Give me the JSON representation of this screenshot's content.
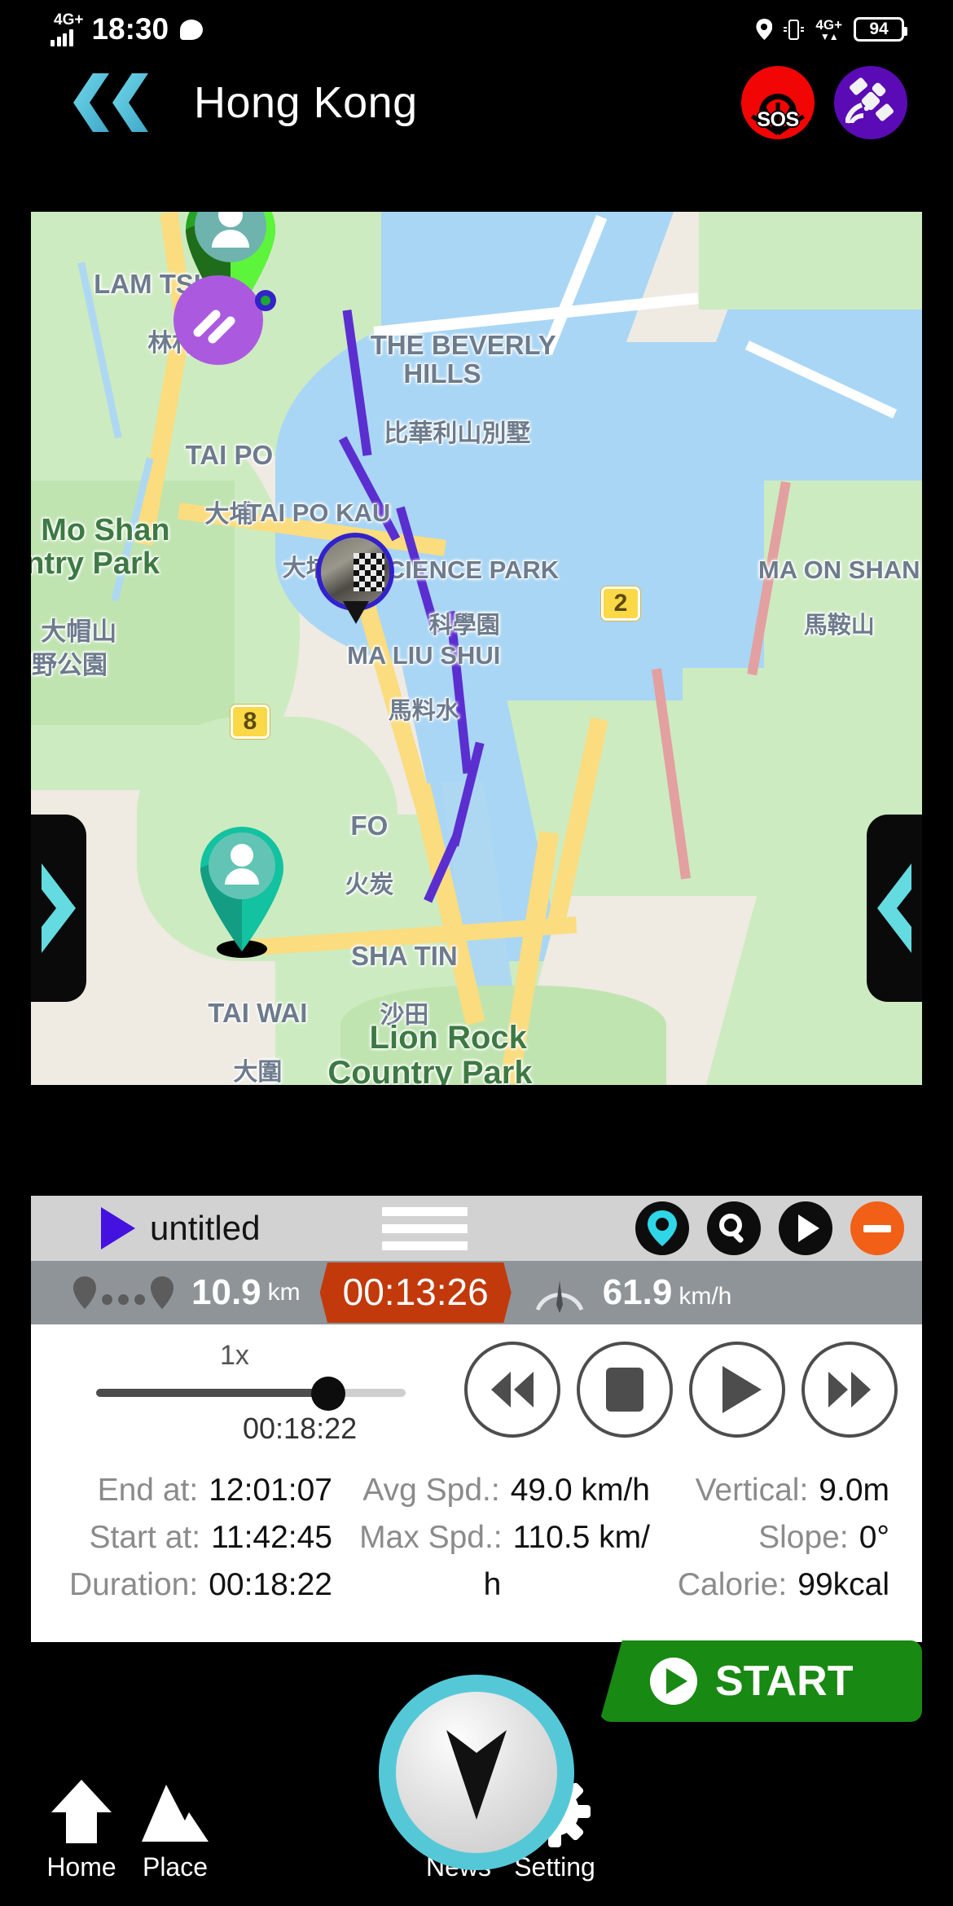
{
  "status_bar": {
    "network_label": "4G+",
    "time": "18:30",
    "message_icon": "message-bubble-icon",
    "location_icon": "location-pin-icon",
    "vibrate_icon": "vibrate-icon",
    "data_network_label": "4G+",
    "battery_level": "94"
  },
  "header": {
    "back_label": "back-double-chevron",
    "title": "Hong Kong",
    "sos_label": "SOS",
    "satellite_icon": "satellite-icon"
  },
  "map": {
    "labels": [
      {
        "en": "LAM TSUEN",
        "zh": "林村"
      },
      {
        "en": "THE BEVERLY\nHILLS",
        "zh": "比華利山別墅"
      },
      {
        "en": "TAI PO",
        "zh": "大埔"
      },
      {
        "en": "TAI PO KAU",
        "zh": "大埔滘"
      },
      {
        "en": "SCIENCE PARK",
        "zh": "科學園"
      },
      {
        "en": "MA ON SHAN",
        "zh": "馬鞍山"
      },
      {
        "en": "MA LIU SHUI",
        "zh": "馬料水"
      },
      {
        "en": "Mo Shan\nuntry Park",
        "zh": "大帽山\n郊野公園"
      },
      {
        "en": "FO",
        "zh": "火炭"
      },
      {
        "en": "SHA TIN",
        "zh": "沙田"
      },
      {
        "en": "TAI WAI",
        "zh": "大圍"
      },
      {
        "en": "Lion Rock\nCountry Park",
        "zh": ""
      }
    ],
    "route_shields": [
      "2",
      "8"
    ],
    "left_arrow_icon": "chevron-right-icon",
    "right_arrow_icon": "chevron-left-icon",
    "markers": {
      "green_pin": "person-marker-green",
      "teal_pin": "person-marker-teal",
      "heading_marker": "direction-heading-marker",
      "start_dot": "route-start-dot",
      "photo_marker": "photo-thumbnail-marker"
    }
  },
  "control_bar": {
    "play_icon": "play-triangle-icon",
    "track_title": "untitled",
    "menu_icon": "hamburger-menu-icon",
    "locate_icon": "locate-pin-icon",
    "search_icon": "search-icon",
    "play_circle_icon": "play-circle-icon",
    "minus_icon": "minus-circle-icon"
  },
  "stats_bar": {
    "distance_icon": "distance-icon",
    "distance_value": "10.9",
    "distance_unit": "km",
    "elapsed_time": "00:13:26",
    "speed_icon": "speedometer-icon",
    "speed_value": "61.9",
    "speed_unit": "km/h"
  },
  "playback": {
    "speed_label": "1x",
    "position_time": "00:18:22",
    "progress_percent": 75,
    "rewind_icon": "rewind-icon",
    "stop_icon": "stop-icon",
    "play_icon": "play-icon",
    "forward_icon": "fast-forward-icon"
  },
  "details": {
    "rows": [
      [
        {
          "label": "End at:",
          "value": "12:01:07"
        },
        {
          "label": "Avg Spd.:",
          "value": "49.0 km/h"
        },
        {
          "label": "Vertical:",
          "value": "9.0m"
        }
      ],
      [
        {
          "label": "Start at:",
          "value": "11:42:45"
        },
        {
          "label": "Max Spd.:",
          "value": "110.5 km/"
        },
        {
          "label": "Slope:",
          "value": "0°"
        }
      ],
      [
        {
          "label": "Duration:",
          "value": "00:18:22"
        },
        {
          "label": "",
          "value": "h"
        },
        {
          "label": "Calorie:",
          "value": "99kcal"
        }
      ]
    ]
  },
  "start_button": {
    "label": "START",
    "icon": "play-circle-icon",
    "color": "#188912"
  },
  "bottom_nav": {
    "items": [
      {
        "label": "Home",
        "icon": "home-arrow-icon"
      },
      {
        "label": "Place",
        "icon": "mountain-icon"
      },
      {
        "label": "News",
        "icon": "rss-icon"
      },
      {
        "label": "Setting",
        "icon": "gear-icon"
      }
    ],
    "compass_icon": "compass-needle-icon",
    "accent_color": "#55c8d8"
  }
}
